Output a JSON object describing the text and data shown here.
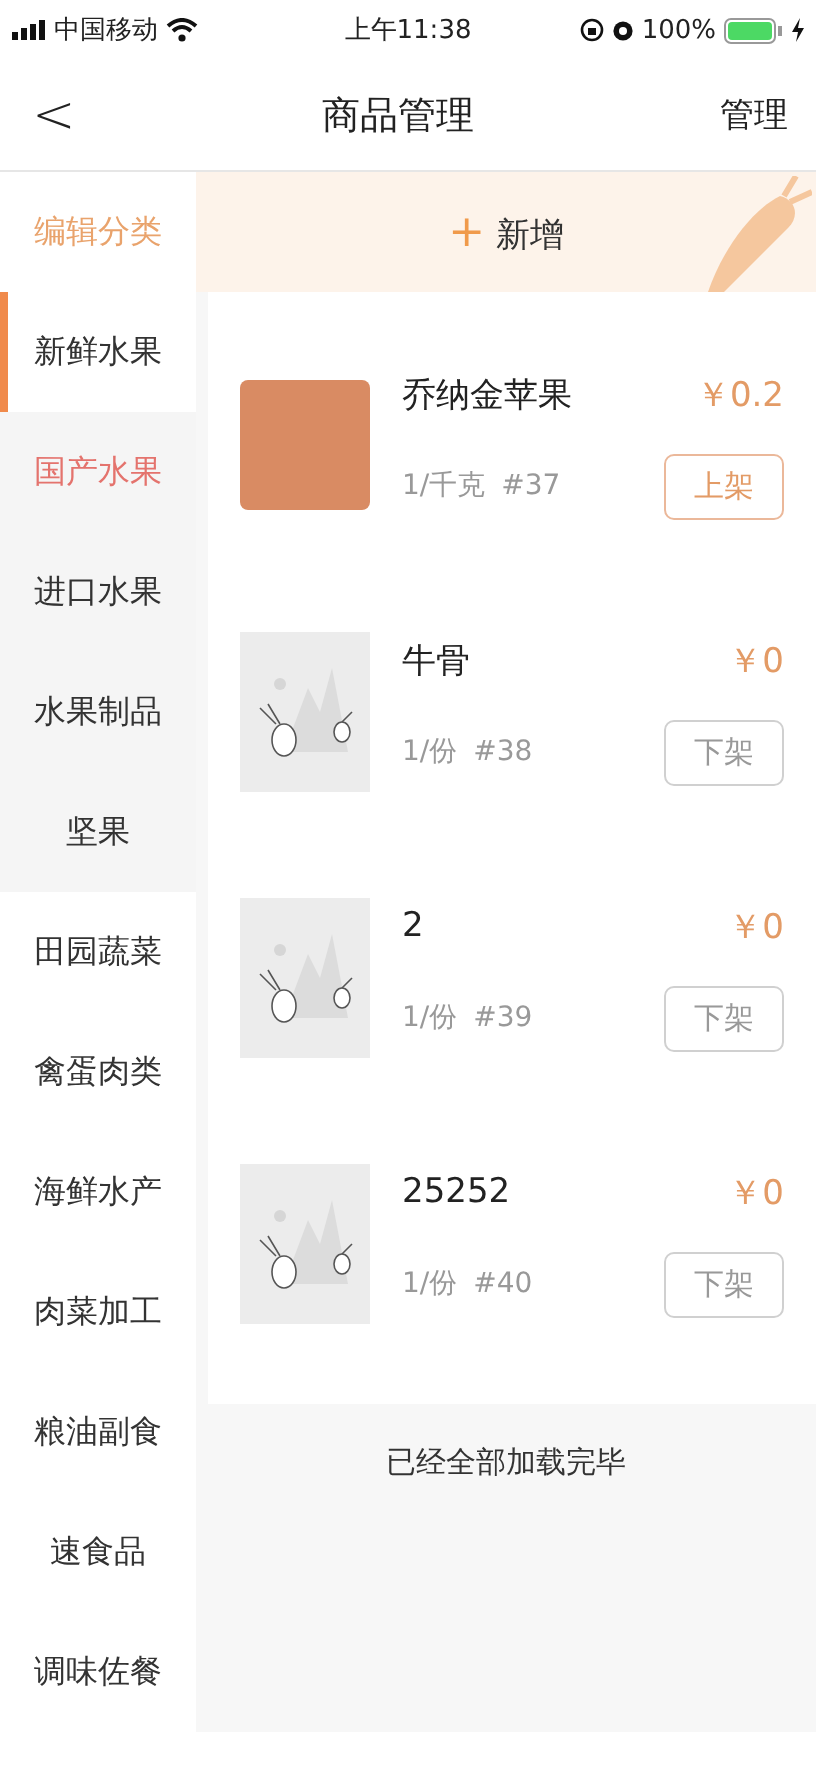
{
  "status_bar": {
    "carrier": "中国移动",
    "time": "上午11:38",
    "battery": "100%"
  },
  "nav": {
    "back": "<",
    "title": "商品管理",
    "action": "管理"
  },
  "sidebar": {
    "header": "编辑分类",
    "items": [
      {
        "label": "新鲜水果",
        "selected": true,
        "children": [
          {
            "label": "国产水果",
            "selected": true
          },
          {
            "label": "进口水果",
            "selected": false
          },
          {
            "label": "水果制品",
            "selected": false
          },
          {
            "label": "坚果",
            "selected": false
          }
        ]
      },
      {
        "label": "田园蔬菜",
        "selected": false
      },
      {
        "label": "禽蛋肉类",
        "selected": false
      },
      {
        "label": "海鲜水产",
        "selected": false
      },
      {
        "label": "肉菜加工",
        "selected": false
      },
      {
        "label": "粮油副食",
        "selected": false
      },
      {
        "label": "速食品",
        "selected": false
      },
      {
        "label": "调味佐餐",
        "selected": false
      }
    ]
  },
  "add_bar": {
    "icon": "+",
    "label": "新增"
  },
  "products": [
    {
      "name": "乔纳金苹果",
      "price": "￥0.2",
      "unit": "1/千克",
      "code": "#37",
      "image": {
        "kind": "photo"
      },
      "action": {
        "label": "上架",
        "highlighted": true
      }
    },
    {
      "name": "牛骨",
      "price": "￥0",
      "unit": "1/份",
      "code": "#38",
      "image": {
        "kind": "placeholder"
      },
      "action": {
        "label": "下架",
        "highlighted": false
      }
    },
    {
      "name": "2",
      "price": "￥0",
      "unit": "1/份",
      "code": "#39",
      "image": {
        "kind": "placeholder"
      },
      "action": {
        "label": "下架",
        "highlighted": false
      }
    },
    {
      "name": "25252",
      "price": "￥0",
      "unit": "1/份",
      "code": "#40",
      "image": {
        "kind": "placeholder"
      },
      "action": {
        "label": "下架",
        "highlighted": false
      }
    }
  ],
  "footer": "已经全部加载完毕"
}
